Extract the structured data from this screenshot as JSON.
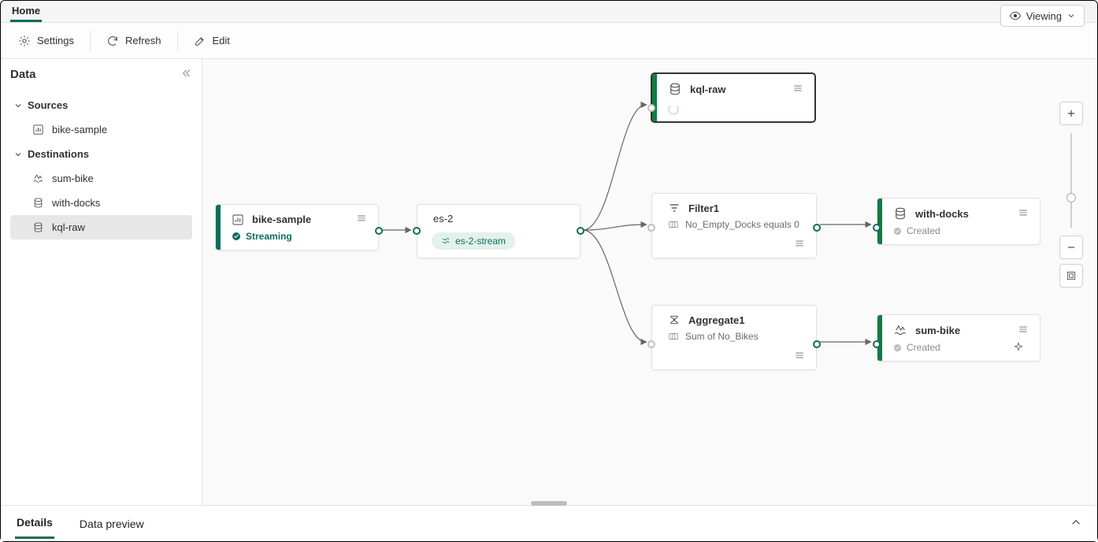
{
  "header": {
    "tab_label": "Home",
    "viewing_label": "Viewing"
  },
  "toolbar": {
    "settings": "Settings",
    "refresh": "Refresh",
    "edit": "Edit"
  },
  "sidebar": {
    "title": "Data",
    "sections": {
      "sources": {
        "label": "Sources",
        "items": [
          {
            "label": "bike-sample",
            "icon": "chart"
          }
        ]
      },
      "destinations": {
        "label": "Destinations",
        "items": [
          {
            "label": "sum-bike",
            "icon": "lake"
          },
          {
            "label": "with-docks",
            "icon": "db"
          },
          {
            "label": "kql-raw",
            "icon": "db",
            "selected": true
          }
        ]
      }
    }
  },
  "canvas": {
    "nodes": {
      "bike_sample": {
        "title": "bike-sample",
        "status": "Streaming"
      },
      "es2": {
        "title": "es-2",
        "tag": "es-2-stream"
      },
      "kql_raw": {
        "title": "kql-raw"
      },
      "filter1": {
        "title": "Filter1",
        "detail": "No_Empty_Docks equals 0"
      },
      "aggregate1": {
        "title": "Aggregate1",
        "detail": "Sum of No_Bikes"
      },
      "with_docks": {
        "title": "with-docks",
        "status": "Created"
      },
      "sum_bike": {
        "title": "sum-bike",
        "status": "Created"
      }
    }
  },
  "bottom": {
    "tabs": {
      "details": "Details",
      "preview": "Data preview"
    }
  },
  "colors": {
    "brand": "#0f6c5b",
    "muted": "#8a8a8a"
  }
}
